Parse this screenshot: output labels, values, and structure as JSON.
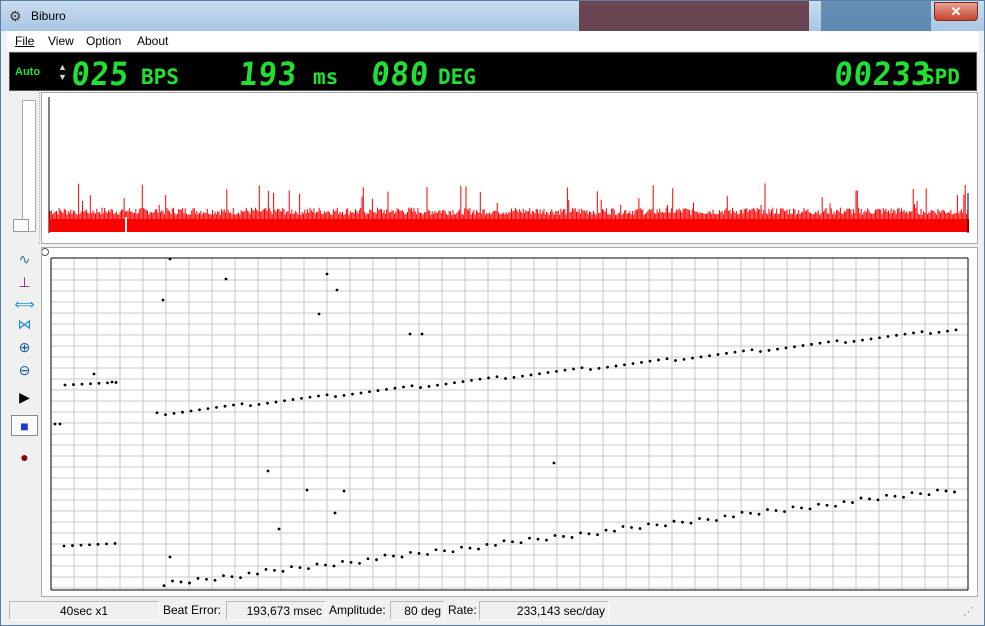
{
  "window": {
    "title": "Biburo",
    "close_label": "✕"
  },
  "menu": [
    {
      "label": "File"
    },
    {
      "label": "View"
    },
    {
      "label": "Option"
    },
    {
      "label": "About"
    }
  ],
  "display": {
    "mode": "Auto",
    "bph_digits": "025",
    "bph_unit": "BPS",
    "beat_digits": "193",
    "beat_unit": "ms",
    "amp_digits": "080",
    "amp_unit": "DEG",
    "rate_digits": "00233",
    "rate_unit": "SPD",
    "lcd_color": "#20e030"
  },
  "waveform": {
    "color": "#ff0000"
  },
  "toolbar": [
    {
      "name": "sine-wave-icon",
      "glyph": "∿"
    },
    {
      "name": "scale-icon",
      "glyph": "⊥"
    },
    {
      "name": "expand-horizontal-icon",
      "glyph": "⟺"
    },
    {
      "name": "compress-icon",
      "glyph": "⋈"
    },
    {
      "name": "zoom-in-icon",
      "glyph": "⊕"
    },
    {
      "name": "zoom-out-icon",
      "glyph": "⊖"
    },
    {
      "name": "play-icon",
      "glyph": "▶"
    },
    {
      "name": "stop-icon",
      "glyph": "■"
    },
    {
      "name": "record-icon",
      "glyph": "●"
    }
  ],
  "status": {
    "timebase": "40sec x1",
    "beat_error_label": "Beat Error:",
    "beat_error_value": "193,673 msec",
    "amplitude_label": "Amplitude:",
    "amplitude_value": "80 deg",
    "rate_label": "Rate:",
    "rate_value": "233,143 sec/day"
  }
}
